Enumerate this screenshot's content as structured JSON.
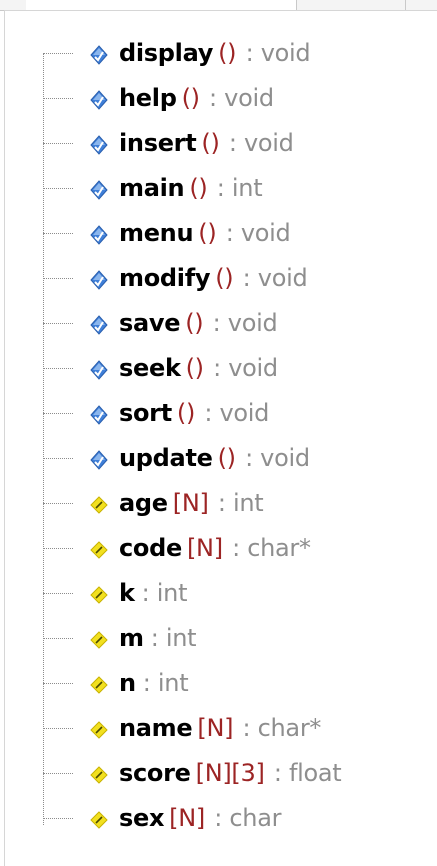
{
  "tree": {
    "methods": [
      {
        "name": "display",
        "params": "()",
        "type": " : void"
      },
      {
        "name": "help",
        "params": "()",
        "type": " : void"
      },
      {
        "name": "insert",
        "params": "()",
        "type": " : void"
      },
      {
        "name": "main",
        "params": "()",
        "type": " : int"
      },
      {
        "name": "menu",
        "params": "()",
        "type": " : void"
      },
      {
        "name": "modify",
        "params": "()",
        "type": " : void"
      },
      {
        "name": "save",
        "params": "()",
        "type": " : void"
      },
      {
        "name": "seek",
        "params": "()",
        "type": " : void"
      },
      {
        "name": "sort",
        "params": "()",
        "type": " : void"
      },
      {
        "name": "update",
        "params": "()",
        "type": " : void"
      }
    ],
    "variables": [
      {
        "name": "age",
        "params": "[N]",
        "type": " : int"
      },
      {
        "name": "code",
        "params": "[N]",
        "type": " : char*"
      },
      {
        "name": "k",
        "params": "",
        "type": ": int"
      },
      {
        "name": "m",
        "params": "",
        "type": ": int"
      },
      {
        "name": "n",
        "params": "",
        "type": ": int"
      },
      {
        "name": "name",
        "params": "[N]",
        "type": " : char*"
      },
      {
        "name": "score",
        "params": "[N][3]",
        "type": " : float"
      },
      {
        "name": "sex",
        "params": "[N]",
        "type": " : char"
      }
    ]
  },
  "icons": {
    "method": "function-icon",
    "variable": "variable-icon",
    "method_color": "#3f7fd8",
    "variable_color": "#f2e01f"
  }
}
